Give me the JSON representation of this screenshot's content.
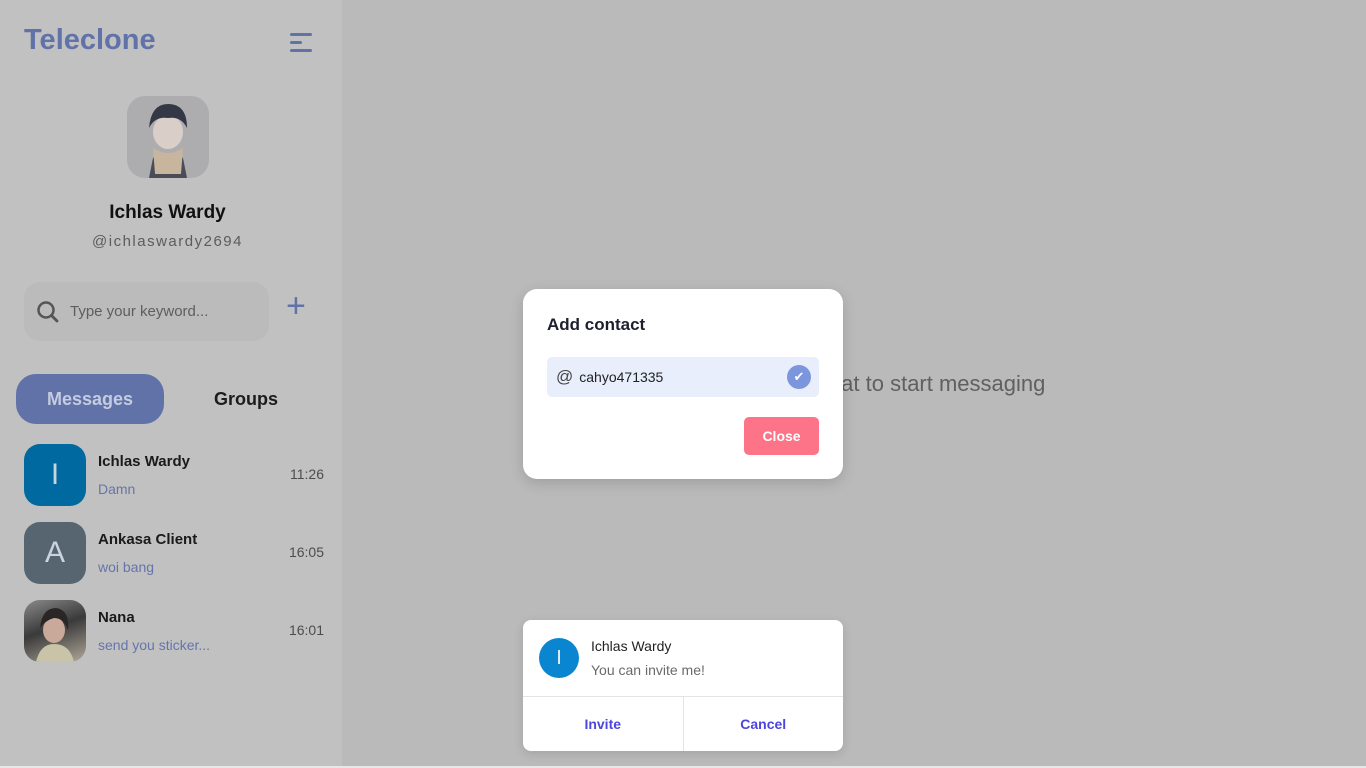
{
  "sidebar": {
    "brand": "Teleclone",
    "menu_icon": "hamburger-menu-icon",
    "profile": {
      "name": "Ichlas Wardy",
      "handle": "@ichlaswardy2694"
    },
    "search": {
      "placeholder": "Type your keyword...",
      "value": ""
    },
    "add_icon": "plus-icon",
    "tabs": [
      {
        "label": "Messages",
        "active": true
      },
      {
        "label": "Groups",
        "active": false
      }
    ],
    "chats": [
      {
        "initial": "I",
        "name": "Ichlas Wardy",
        "last_message": "Damn",
        "time": "11:26",
        "color": "#006aa0"
      },
      {
        "initial": "A",
        "name": "Ankasa Client",
        "last_message": "woi bang",
        "time": "16:05",
        "color": "#566570"
      },
      {
        "initial": "",
        "name": "Nana",
        "last_message": "send you sticker...",
        "time": "16:01",
        "color": "#6b6b6b"
      }
    ]
  },
  "main": {
    "hint": "Please select a chat to start messaging"
  },
  "modal": {
    "title": "Add contact",
    "at_symbol": "@",
    "username_value": "cahyo471335",
    "close_label": "Close"
  },
  "toast": {
    "initial": "I",
    "name": "Ichlas Wardy",
    "message": "You can invite me!",
    "invite_label": "Invite",
    "cancel_label": "Cancel"
  },
  "colors": {
    "accent": "#6072a8",
    "danger": "#fd7387",
    "link": "#4d45e0"
  }
}
